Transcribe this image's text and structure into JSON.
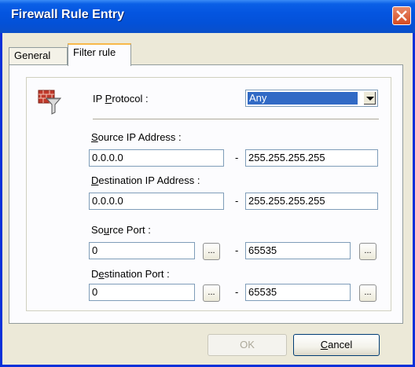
{
  "window": {
    "title": "Firewall Rule Entry"
  },
  "tabs": [
    {
      "label": "General",
      "selected": false
    },
    {
      "label": "Filter rule",
      "selected": true
    }
  ],
  "filter": {
    "protocol": {
      "label_pre": "IP ",
      "label_u": "P",
      "label_post": "rotocol :",
      "value": "Any"
    },
    "source_ip": {
      "label_u": "S",
      "label_post": "ource IP Address :",
      "from": "0.0.0.0",
      "to": "255.255.255.255"
    },
    "dest_ip": {
      "label_u": "D",
      "label_post": "estination IP Address :",
      "from": "0.0.0.0",
      "to": "255.255.255.255"
    },
    "source_port": {
      "label_pre": "So",
      "label_u": "u",
      "label_post": "rce Port :",
      "from": "0",
      "to": "65535"
    },
    "dest_port": {
      "label_pre": "D",
      "label_u": "e",
      "label_post": "stination Port :",
      "from": "0",
      "to": "65535"
    },
    "range_separator": "-",
    "browse_label": "..."
  },
  "buttons": {
    "ok": {
      "label": "OK",
      "enabled": false
    },
    "cancel": {
      "label_u": "C",
      "label_post": "ancel",
      "enabled": true
    }
  },
  "colors": {
    "titlebar": "#0455e0",
    "selection": "#316ac5",
    "tab_highlight": "#f8b84a"
  },
  "icons": {
    "rule": "firewall-funnel-icon",
    "close": "close-icon",
    "dropdown": "chevron-down-icon"
  }
}
